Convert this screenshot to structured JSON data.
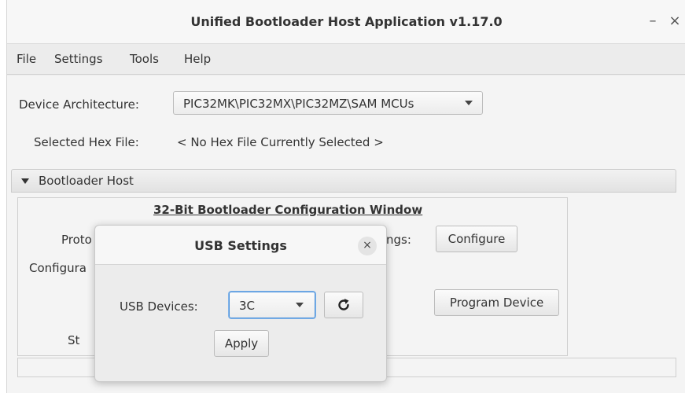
{
  "window": {
    "title": "Unified Bootloader Host Application v1.17.0",
    "minimize_glyph": "–",
    "close_glyph": "×"
  },
  "menu": [
    "File",
    "Settings",
    "Tools",
    "Help"
  ],
  "device_architecture": {
    "label": "Device Architecture:",
    "value": "PIC32MK\\PIC32MX\\PIC32MZ\\SAM MCUs"
  },
  "hex_file": {
    "label": "Selected Hex File:",
    "value": "< No Hex File Currently Selected >"
  },
  "bootloader_host": {
    "section_title": "Bootloader Host",
    "panel_title": "32-Bit Bootloader Configuration Window",
    "protocol_label_partial": "Proto",
    "settings_label_partial": "ngs:",
    "configure_button": "Configure",
    "configuration_label_partial": "Configura",
    "program_button": "Program Device",
    "status_label_partial": "St"
  },
  "usb_dialog": {
    "title": "USB Settings",
    "close_glyph": "×",
    "devices_label": "USB Devices:",
    "devices_value": "3C",
    "apply_button": "Apply",
    "refresh_icon": "refresh-icon"
  }
}
